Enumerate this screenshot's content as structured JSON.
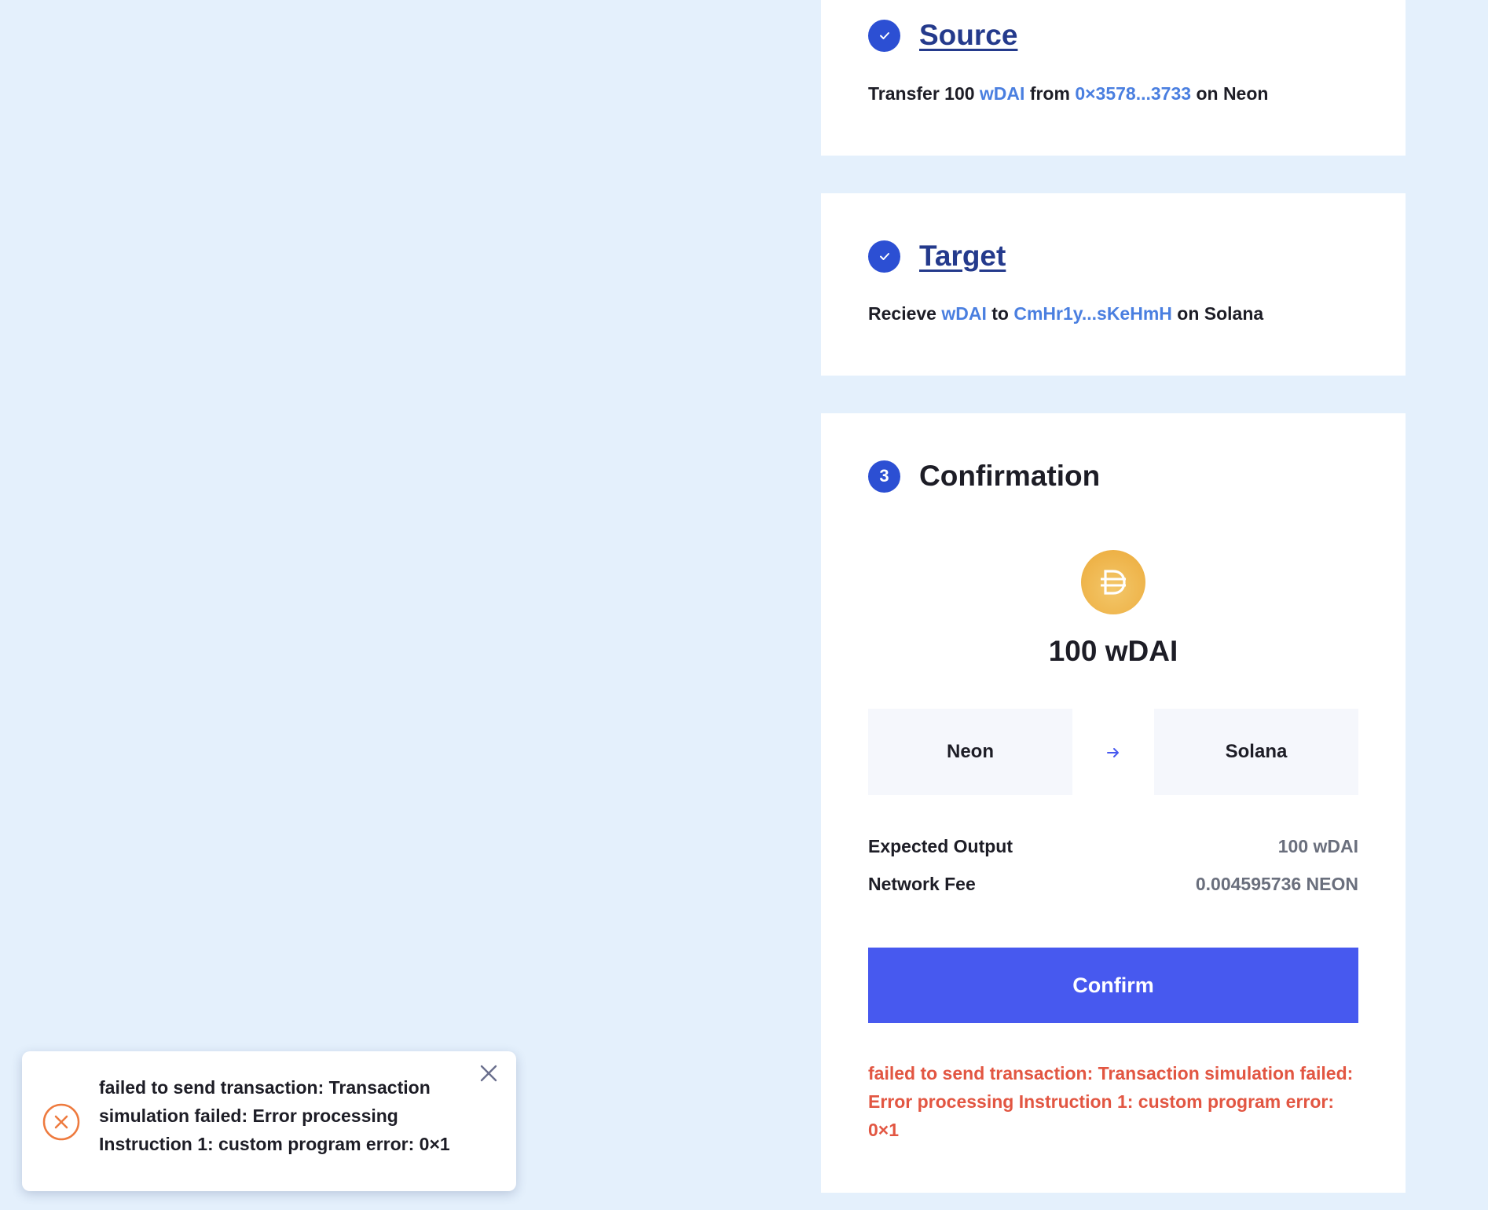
{
  "source": {
    "title": "Source",
    "desc_prefix": "Transfer 100",
    "token": "wDAI",
    "from_word": "from",
    "address": "0×3578...3733",
    "network_suffix": "on Neon"
  },
  "target": {
    "title": "Target",
    "desc_prefix": "Recieve",
    "token": "wDAI",
    "to_word": "to",
    "address": "CmHr1y...sKeHmH",
    "network_suffix": "on Solana"
  },
  "confirmation": {
    "step_number": "3",
    "title": "Confirmation",
    "token_icon": "dai-token-icon",
    "amount": "100 wDAI",
    "from_network": "Neon",
    "to_network": "Solana",
    "expected_output_label": "Expected Output",
    "expected_output_value": "100 wDAI",
    "network_fee_label": "Network Fee",
    "network_fee_value": "0.004595736 NEON",
    "confirm_label": "Confirm",
    "error_message": "failed to send transaction: Transaction simulation failed: Error processing Instruction 1: custom program error: 0×1"
  },
  "toast": {
    "icon": "error-circle-icon",
    "message": "failed to send transaction: Transaction simulation failed: Error processing Instruction 1: custom program error: 0×1"
  },
  "colors": {
    "background": "#e4f0fc",
    "accent": "#4759ef",
    "step_badge": "#2c4fd3",
    "link": "#4a7fe0",
    "error": "#e25642",
    "toast_icon": "#ee7a3e"
  }
}
